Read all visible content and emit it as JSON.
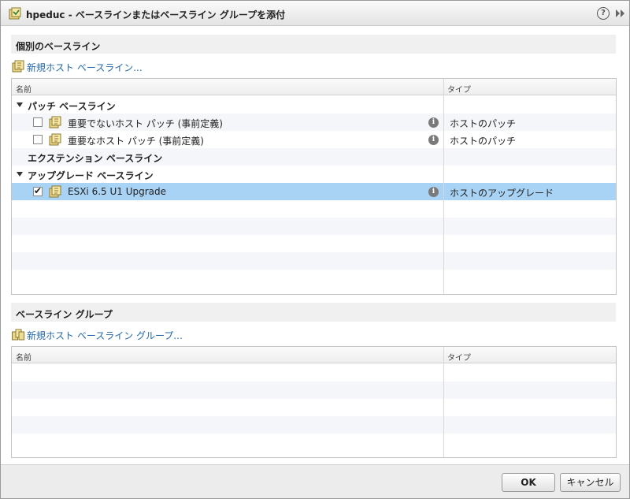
{
  "window": {
    "title": "hpeduc - ベースラインまたはベースライン グループを添付",
    "help_glyph": "?"
  },
  "individual": {
    "header": "個別のベースライン",
    "new_link": "新規ホスト ベースライン...",
    "columns": {
      "name": "名前",
      "type": "タイプ"
    },
    "groups": [
      {
        "label": "パッチ ベースライン",
        "items": [
          {
            "name": "重要でないホスト パッチ (事前定義)",
            "type": "ホストのパッチ",
            "checked": false
          },
          {
            "name": "重要なホスト パッチ (事前定義)",
            "type": "ホストのパッチ",
            "checked": false
          }
        ]
      },
      {
        "label": "エクステンション ベースライン",
        "items": []
      },
      {
        "label": "アップグレード ベースライン",
        "items": [
          {
            "name": "ESXi 6.5 U1 Upgrade",
            "type": "ホストのアップグレード",
            "checked": true
          }
        ]
      }
    ]
  },
  "groups_section": {
    "header": "ベースライン グループ",
    "new_link": "新規ホスト ベースライン グループ...",
    "columns": {
      "name": "名前",
      "type": "タイプ"
    }
  },
  "footer": {
    "ok_label": "OK",
    "cancel_label": "キャンセル"
  },
  "colors": {
    "selected_row": "#a9d3f5",
    "link": "#2467a6"
  }
}
